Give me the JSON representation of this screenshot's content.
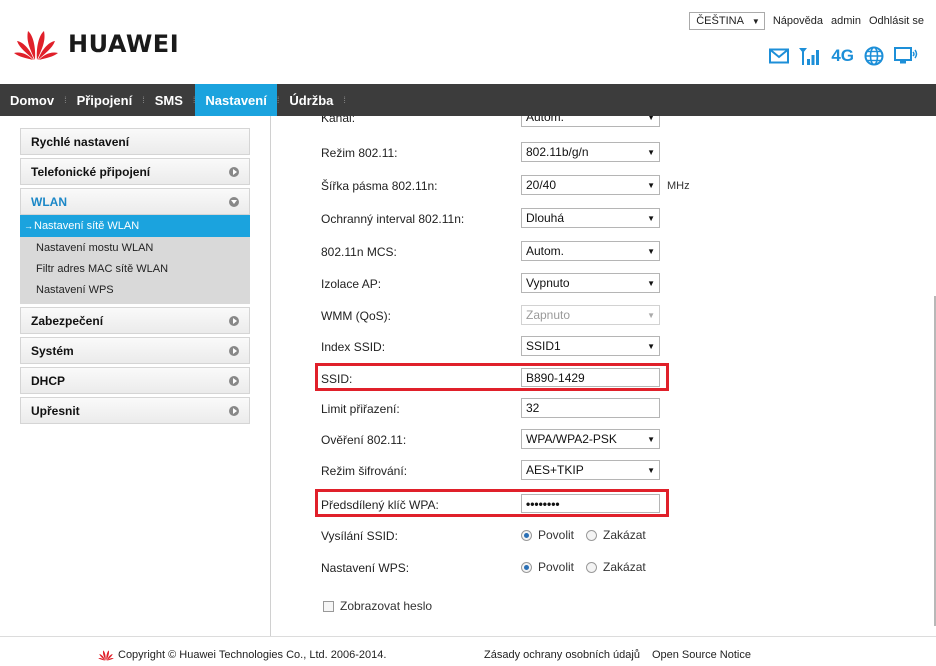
{
  "header": {
    "brand": "HUAWEI",
    "language": "ČEŠTINA",
    "help": "Nápověda",
    "user": "admin",
    "logout": "Odhlásit se",
    "network_type": "4G",
    "icons": [
      "mail-icon",
      "signal-icon",
      "globe-icon",
      "monitor-icon"
    ]
  },
  "nav": {
    "items": [
      "Domov",
      "Připojení",
      "SMS",
      "Nastavení",
      "Údržba"
    ],
    "active": "Nastavení"
  },
  "sidebar": {
    "quick_setup": "Rychlé nastavení",
    "dialup": "Telefonické připojení",
    "wlan": "WLAN",
    "wlan_sub": [
      "Nastavení sítě WLAN",
      "Nastavení mostu WLAN",
      "Filtr adres MAC sítě WLAN",
      "Nastavení WPS"
    ],
    "security": "Zabezpečení",
    "system": "Systém",
    "dhcp": "DHCP",
    "advanced": "Upřesnit"
  },
  "form": {
    "channel": {
      "label": "Kanál:",
      "value": "Autom."
    },
    "mode": {
      "label": "Režim 802.11:",
      "value": "802.11b/g/n"
    },
    "bandwidth": {
      "label": "Šířka pásma 802.11n:",
      "value": "20/40",
      "unit": "MHz"
    },
    "guard": {
      "label": "Ochranný interval 802.11n:",
      "value": "Dlouhá"
    },
    "mcs": {
      "label": "802.11n MCS:",
      "value": "Autom."
    },
    "ap_isolation": {
      "label": "Izolace AP:",
      "value": "Vypnuto"
    },
    "wmm": {
      "label": "WMM (QoS):",
      "value": "Zapnuto"
    },
    "ssid_index": {
      "label": "Index SSID:",
      "value": "SSID1"
    },
    "ssid": {
      "label": "SSID:",
      "value": "B890-1429"
    },
    "limit": {
      "label": "Limit přiřazení:",
      "value": "32"
    },
    "auth": {
      "label": "Ověření 802.11:",
      "value": "WPA/WPA2-PSK"
    },
    "encryption": {
      "label": "Režim šifrování:",
      "value": "AES+TKIP"
    },
    "wpa_key": {
      "label": "Předsdílený klíč WPA:",
      "value": "••••••••"
    },
    "ssid_broadcast": {
      "label": "Vysílání SSID:",
      "enable": "Povolit",
      "disable": "Zakázat"
    },
    "wps": {
      "label": "Nastavení WPS:",
      "enable": "Povolit",
      "disable": "Zakázat"
    },
    "show_password": "Zobrazovat heslo"
  },
  "footer": {
    "copyright": "Copyright © Huawei Technologies Co., Ltd. 2006-2014.",
    "privacy": "Zásady ochrany osobních údajů",
    "open_source": "Open Source Notice"
  },
  "colors": {
    "accent": "#1ba3de",
    "nav_bg": "#3c3c3c",
    "highlight": "#e0202a",
    "logo_red": "#e0202a"
  }
}
